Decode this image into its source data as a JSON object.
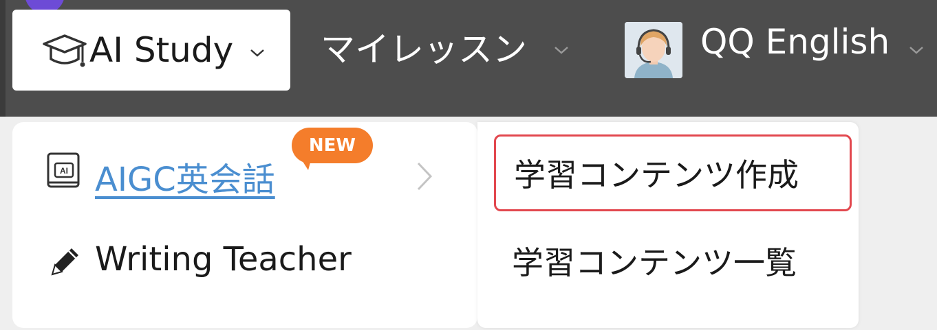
{
  "navbar": {
    "active_item": {
      "label": "AI Study",
      "icon": "graduation-cap-icon"
    },
    "items": [
      {
        "label": "マイレッスン"
      },
      {
        "label": "QQ English",
        "avatar": "support-agent-avatar"
      }
    ]
  },
  "menu": {
    "items": [
      {
        "label": "AIGC英会話",
        "icon": "ai-book-icon",
        "badge": "NEW",
        "has_submenu": true
      },
      {
        "label": "Writing Teacher",
        "icon": "pencil-icon"
      }
    ]
  },
  "submenu": {
    "items": [
      {
        "label": "学習コンテンツ作成",
        "highlighted": true
      },
      {
        "label": "学習コンテンツ一覧"
      }
    ]
  },
  "colors": {
    "navbar_bg": "#4d4d4d",
    "link": "#4a8ed0",
    "badge": "#f47d2b",
    "highlight_border": "#e2474e"
  }
}
